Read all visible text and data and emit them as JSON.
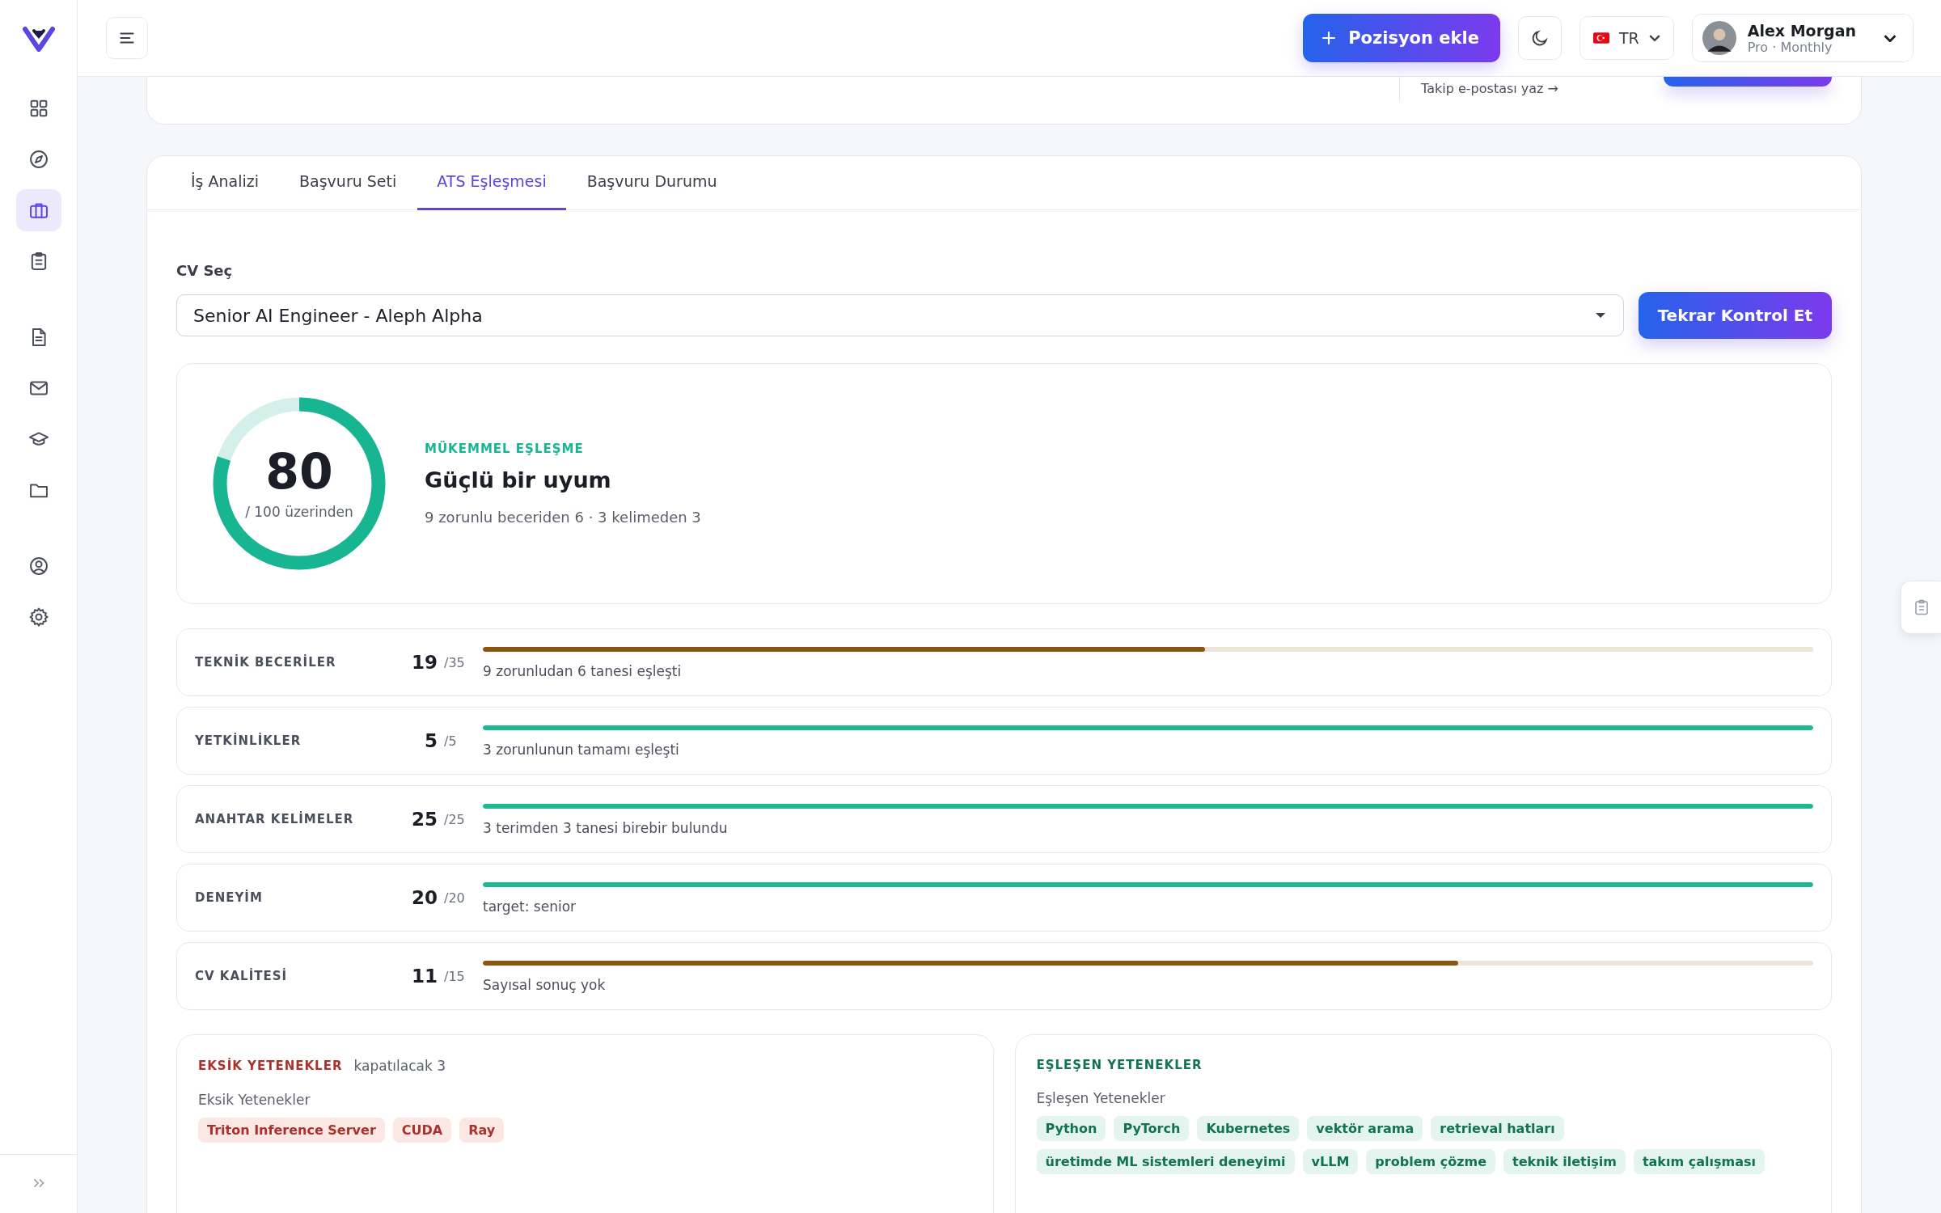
{
  "sidebar": {
    "items": [
      {
        "kind": "grid",
        "selected": false
      },
      {
        "kind": "compass",
        "selected": false
      },
      {
        "kind": "briefcase",
        "selected": true
      },
      {
        "kind": "clipboard",
        "selected": false
      },
      {
        "kind": "document",
        "selected": false
      },
      {
        "kind": "mail",
        "selected": false
      },
      {
        "kind": "cap",
        "selected": false
      },
      {
        "kind": "folder",
        "selected": false
      },
      {
        "kind": "user",
        "selected": false
      },
      {
        "kind": "gear",
        "selected": false
      }
    ]
  },
  "header": {
    "add_button": "Pozisyon ekle",
    "language": "TR",
    "user": {
      "name": "Alex Morgan",
      "plan": "Pro · Monthly"
    }
  },
  "top_card": {
    "link": "Takip e-postası yaz →"
  },
  "tabs": [
    {
      "label": "İş Analizi",
      "selected": false
    },
    {
      "label": "Başvuru Seti",
      "selected": false
    },
    {
      "label": "ATS Eşleşmesi",
      "selected": true
    },
    {
      "label": "Başvuru Durumu",
      "selected": false
    }
  ],
  "cv_select": {
    "label": "CV Seç",
    "value": "Senior AI Engineer - Aleph Alpha"
  },
  "recheck_button": "Tekrar Kontrol Et",
  "score": {
    "value": "80",
    "caption": "/ 100 üzerinden",
    "level": 0.8,
    "badge": "MÜKEMMEL EŞLEŞME",
    "title": "Güçlü bir uyum",
    "summary": "9 zorunlu beceriden 6 · 3 kelimeden 3"
  },
  "categories": [
    {
      "label": "TEKNİK BECERİLER",
      "score": "19",
      "max": "/35",
      "level": 0.543,
      "note": "9 zorunludan 6 tanesi eşleşti"
    },
    {
      "label": "YETKİNLİKLER",
      "score": "5",
      "max": "/5",
      "level": 1,
      "note": "3 zorunlunun tamamı eşleşti"
    },
    {
      "label": "ANAHTAR KELİMELER",
      "score": "25",
      "max": "/25",
      "level": 1,
      "note": "3 terimden 3 tanesi birebir bulundu"
    },
    {
      "label": "DENEYİM",
      "score": "20",
      "max": "/20",
      "level": 1,
      "note": "target: senior"
    },
    {
      "label": "CV KALİTESİ",
      "score": "11",
      "max": "/15",
      "level": 0.733,
      "note": "Sayısal sonuç yok"
    }
  ],
  "missing": {
    "title": "EKSİK YETENEKLER",
    "count": "kapatılacak 3",
    "subtitle": "Eksik Yetenekler",
    "tags": [
      "Triton Inference Server",
      "CUDA",
      "Ray"
    ]
  },
  "matched": {
    "title": "EŞLEŞEN YETENEKLER",
    "subtitle": "Eşleşen Yetenekler",
    "tags": [
      "Python",
      "PyTorch",
      "Kubernetes",
      "vektör arama",
      "retrieval hatları",
      "üretimde ML sistemleri deneyimi",
      "vLLM",
      "problem çözme",
      "teknik iletişim",
      "takım çalışması"
    ]
  }
}
